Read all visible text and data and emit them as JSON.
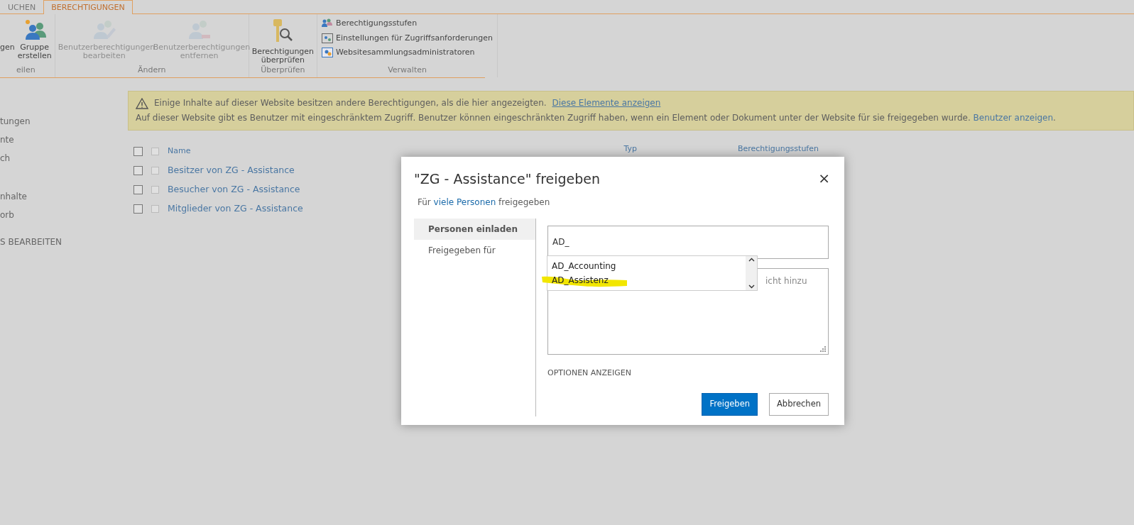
{
  "ribbon": {
    "tabs": [
      {
        "label": "UCHEN",
        "selected": false
      },
      {
        "label": "BERECHTIGUNGEN",
        "selected": true
      }
    ],
    "groups": [
      {
        "label": "eilen",
        "items": [
          {
            "kind": "large",
            "label": "gen",
            "disabled": false
          },
          {
            "kind": "large",
            "label": "Gruppe erstellen",
            "disabled": false
          }
        ]
      },
      {
        "label": "Ändern",
        "items": [
          {
            "kind": "large",
            "label": "Benutzerberechtigungen bearbeiten",
            "disabled": true
          },
          {
            "kind": "large",
            "label": "Benutzerberechtigungen entfernen",
            "disabled": true
          }
        ]
      },
      {
        "label": "Überprüfen",
        "items": [
          {
            "kind": "large",
            "label": "Berechtigungen überprüfen",
            "disabled": false
          }
        ]
      },
      {
        "label": "Verwalten",
        "items": [
          {
            "kind": "small",
            "label": "Berechtigungsstufen",
            "disabled": false
          },
          {
            "kind": "small",
            "label": "Einstellungen für Zugriffsanforderungen",
            "disabled": false
          },
          {
            "kind": "small",
            "label": "Websitesammlungsadministratoren",
            "disabled": false
          }
        ]
      }
    ]
  },
  "sidebar": {
    "items": [
      "tungen",
      "nte",
      "ch",
      "nhalte",
      "orb",
      "S BEARBEITEN"
    ]
  },
  "banner": {
    "lines": [
      {
        "text": "Einige Inhalte auf dieser Website besitzen andere Berechtigungen, als die hier angezeigten.",
        "link": "Diese Elemente anzeigen"
      },
      {
        "text": "Auf dieser Website gibt es Benutzer mit eingeschränktem Zugriff. Benutzer können eingeschränkten Zugriff haben, wenn ein Element oder Dokument unter der Website für sie freigegeben wurde.",
        "link": "Benutzer anzeigen",
        "suffix": "."
      }
    ]
  },
  "table": {
    "all_checked": false,
    "columns": [
      "Name",
      "Typ",
      "Berechtigungsstufen"
    ],
    "rows": [
      {
        "name": "Besitzer von ZG - Assistance",
        "checked": false
      },
      {
        "name": "Besucher von ZG - Assistance",
        "checked": false
      },
      {
        "name": "Mitglieder von ZG - Assistance",
        "checked": false
      }
    ]
  },
  "dialog": {
    "title": "\"ZG - Assistance\" freigeben",
    "close": "×",
    "subtitle": {
      "before": "Für",
      "link": "viele Personen",
      "after": "freigegeben"
    },
    "nav": [
      {
        "label": "Personen einladen",
        "selected": true
      },
      {
        "label": "Freigegeben für",
        "selected": false
      }
    ],
    "people_field": {
      "value": "AD_"
    },
    "suggestions": [
      "AD_Accounting",
      "AD_Assistenz"
    ],
    "message_field": {
      "placeholder": "icht hinzu"
    },
    "options_link": "OPTIONEN ANZEIGEN",
    "buttons": [
      {
        "label": "Freigeben",
        "kind": "primary"
      },
      {
        "label": "Abbrechen",
        "kind": "secondary"
      }
    ]
  }
}
